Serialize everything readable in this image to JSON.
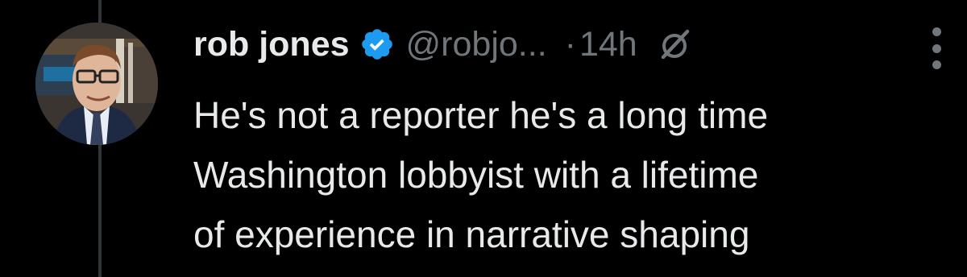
{
  "tweet": {
    "author": {
      "display_name": "rob jones",
      "handle": "@robjo...",
      "verified": true,
      "verified_color": "#1d9bf0"
    },
    "separator": "·",
    "time": "14h",
    "icons": {
      "verified": "verified-badge-icon",
      "grok": "grok-icon",
      "more": "more-options-icon"
    },
    "text_lines": [
      "He's not a reporter he's a long time",
      "Washington lobbyist with a lifetime",
      "of experience in narrative shaping"
    ]
  }
}
